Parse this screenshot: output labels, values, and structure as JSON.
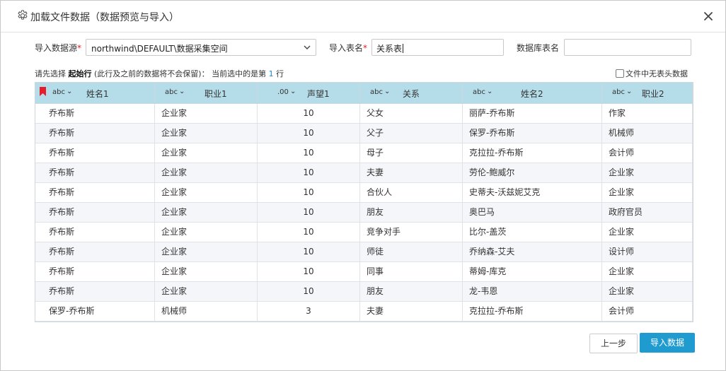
{
  "dialog": {
    "title": "加载文件数据（数据预览与导入）",
    "title_icon": "gear-icon",
    "close_icon": "close-icon"
  },
  "form": {
    "source_label": "导入数据源",
    "source_value": "northwind\\DEFAULT\\数据采集空间",
    "table_label": "导入表名",
    "table_value": "关系表",
    "db_table_label": "数据库表名",
    "db_table_value": "",
    "required_mark": "*"
  },
  "hint": {
    "prefix": "请先选择 ",
    "bold": "起始行",
    "middle": " (此行及之前的数据将不会保留)：  当前选中的是第 ",
    "row_number": "1",
    "suffix": " 行"
  },
  "no_header_checkbox": {
    "label": "文件中无表头数据",
    "checked": false
  },
  "table": {
    "columns": [
      {
        "type": "abc",
        "name": "姓名1",
        "align": "left"
      },
      {
        "type": "abc",
        "name": "职业1",
        "align": "left"
      },
      {
        "type": ".00",
        "name": "声望1",
        "align": "center"
      },
      {
        "type": "abc",
        "name": "关系",
        "align": "left"
      },
      {
        "type": "abc",
        "name": "姓名2",
        "align": "left"
      },
      {
        "type": "abc",
        "name": "职业2",
        "align": "left"
      }
    ],
    "rows": [
      [
        "乔布斯",
        "企业家",
        "10",
        "父女",
        "丽萨-乔布斯",
        "作家"
      ],
      [
        "乔布斯",
        "企业家",
        "10",
        "父子",
        "保罗-乔布斯",
        "机械师"
      ],
      [
        "乔布斯",
        "企业家",
        "10",
        "母子",
        "克拉拉-乔布斯",
        "会计师"
      ],
      [
        "乔布斯",
        "企业家",
        "10",
        "夫妻",
        "劳伦-鲍威尔",
        "企业家"
      ],
      [
        "乔布斯",
        "企业家",
        "10",
        "合伙人",
        "史蒂夫-沃兹妮艾克",
        "企业家"
      ],
      [
        "乔布斯",
        "企业家",
        "10",
        "朋友",
        "奥巴马",
        "政府官员"
      ],
      [
        "乔布斯",
        "企业家",
        "10",
        "竞争对手",
        "比尔-盖茨",
        "企业家"
      ],
      [
        "乔布斯",
        "企业家",
        "10",
        "师徒",
        "乔纳森-艾夫",
        "设计师"
      ],
      [
        "乔布斯",
        "企业家",
        "10",
        "同事",
        "蒂姆-库克",
        "企业家"
      ],
      [
        "乔布斯",
        "企业家",
        "10",
        "朋友",
        "龙-韦恩",
        "企业家"
      ],
      [
        "保罗-乔布斯",
        "机械师",
        "3",
        "夫妻",
        "克拉拉-乔布斯",
        "会计师"
      ]
    ]
  },
  "buttons": {
    "prev": "上一步",
    "import": "导入数据"
  },
  "colors": {
    "header_bg": "#b5dde9",
    "primary": "#1f9bd0",
    "required": "#e02020",
    "highlight": "#1e88c8"
  }
}
